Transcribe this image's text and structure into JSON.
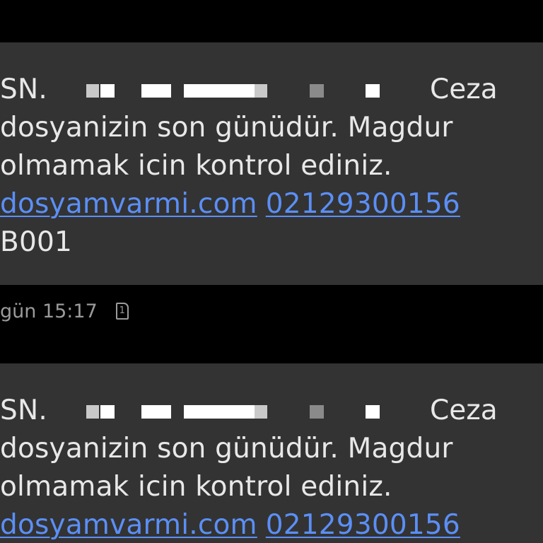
{
  "messages": [
    {
      "prefix": "SN.",
      "ceza": "Ceza",
      "line2": "dosyanizin son günüdür. Magdur",
      "line3": "olmamak icin kontrol ediniz.",
      "link_url": "dosyamvarmi.com",
      "link_phone": "02129300156",
      "code": "B001"
    },
    {
      "prefix": "SN.",
      "ceza": "Ceza",
      "line2": "dosyanizin son günüdür. Magdur",
      "line3": "olmamak icin kontrol ediniz.",
      "link_url": "dosyamvarmi.com",
      "link_phone": "02129300156"
    }
  ],
  "meta": {
    "timestamp": "gün 15:17",
    "sim_label": "1",
    "sim_icon": "sim-card-icon"
  },
  "colors": {
    "background": "#000000",
    "bubble": "#333333",
    "text": "#e8e8e8",
    "link": "#5b8ff6",
    "meta": "#9a9a9a"
  }
}
